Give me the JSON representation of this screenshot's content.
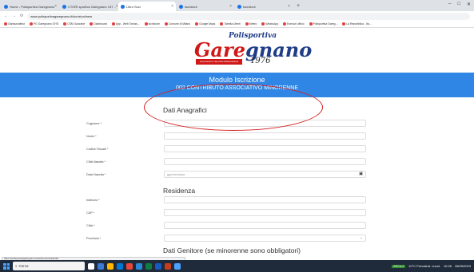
{
  "browser": {
    "tabs": [
      {
        "label": "Home - Polisportiva Garegnano",
        "active": false
      },
      {
        "label": "CTORI sportiva Garegnano 197...",
        "active": false
      },
      {
        "label": "Libro Soci",
        "active": true
      },
      {
        "label": "Iscrizioni",
        "active": false
      },
      {
        "label": "Iscrizioni",
        "active": false
      }
    ],
    "new_tab": "+",
    "window_controls": [
      "–",
      "□",
      "✕"
    ],
    "nav": [
      "←",
      "→",
      "⟳"
    ],
    "url": "www.polisportivagaregnano.it/iscrizioni/new",
    "bookmarks": [
      "Garbazzafinst",
      "PG Garegnano 1976",
      "CSM Gazzane",
      "Dashboard",
      "App - Web Tomas...",
      "Iscrizione",
      "Comune di Milano",
      "Google Maps",
      "Tabella Utenti",
      "Meteo",
      "WhatsApp",
      "Esercizi ufficio",
      "Polisportiva Gareg...",
      "La Repubblica - Ita..."
    ]
  },
  "header": {
    "logo_top": "Polisportiva",
    "logo_main_1": "Gare",
    "logo_main_2": "gnano",
    "logo_banner": "Associazione Sportiva Dilettantistica",
    "logo_year": "1976"
  },
  "band": {
    "title": "Modulo Iscrizione",
    "subtitle": "002 CONTRIBUTO ASSOCIATIVO MINORENNE"
  },
  "form": {
    "section_anagrafici": "Dati Anagrafici",
    "fields_anagrafici": [
      {
        "label": "Cognome *",
        "value": ""
      },
      {
        "label": "Nome *",
        "value": ""
      },
      {
        "label": "Codice Fiscale *",
        "value": ""
      },
      {
        "label": "Città Nascita *",
        "value": ""
      },
      {
        "label": "Data Nascita *",
        "value": "gg/mm/aaaa"
      }
    ],
    "section_residenza": "Residenza",
    "fields_residenza": [
      {
        "label": "Indirizzo *",
        "value": ""
      },
      {
        "label": "CAP *",
        "value": ""
      },
      {
        "label": "Città *",
        "value": ""
      },
      {
        "label": "Provincia *",
        "value": ""
      }
    ],
    "section_genitore": "Dati Genitore (se minorenne sono obbligatori)"
  },
  "statusbar": "https://polisportivagaregnano.it/iscrizioni/modulo/02",
  "taskbar": {
    "search_placeholder": "Cerca",
    "tray_badge": "ARCA-2",
    "weather": "10°C  Prevalent. nuvol.",
    "time": "10:26",
    "date": "28/09/2023"
  }
}
